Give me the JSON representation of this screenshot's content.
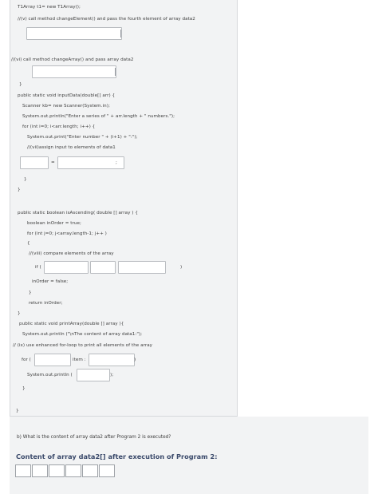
{
  "code_lines": {
    "l01": "T1Array t1= new T1Array();",
    "l02": "//(v) call method changeElement() and pass the fourth element of array data2",
    "l03": "//(vi) call method changeArray() and pass array data2",
    "l04": "}",
    "l05": "public static void inputData(double[] arr) {",
    "l06": "Scanner kb= new Scanner(System.in);",
    "l07": "System.out.println(\"Enter a series of \" + arr.length + \" numbers.\");",
    "l08": "for (int i=0; i<arr.length; i++) {",
    "l09": "System.out.print(\"Enter number \" + (i+1) + \":\");",
    "l10": "//(vii)assign input to elements of data1",
    "l11": "=",
    "l12": ";",
    "l13": "}",
    "l14": "}",
    "l15": "public static boolean isAscending( double [] array ) {",
    "l16": "boolean inOrder = true;",
    "l17": "for (int j=0; j<array.length-1; j++ )",
    "l18": "{",
    "l19": "//(viii) compare elements of the array",
    "l20": "if (",
    "l21": ")",
    "l22": "inOrder = false;",
    "l23": "}",
    "l24": "return inOrder;",
    "l25": "}",
    "l26": "public static void printArray(double [] array ){",
    "l27": "System.out.println (\"\\nThe content of array data1:\");",
    "l28": "// (ix) use enhanced for-loop to print all elements of the array",
    "l29": "for (",
    "l30": "item :",
    "l31": ")",
    "l32": "System.out.println (",
    "l33": ");",
    "l34": "}",
    "l35": "}"
  },
  "question_b": "b) What is the content of array data2 after Program 2 is executed?",
  "answer_heading": "Content of array data2[] after execution of Program 2:",
  "answer_cells": [
    "",
    "",
    "",
    "",
    "",
    ""
  ],
  "colors": {
    "panel_bg": "#f2f3f4",
    "heading": "#3b4a6b",
    "field_border": "#b9bcc0"
  }
}
